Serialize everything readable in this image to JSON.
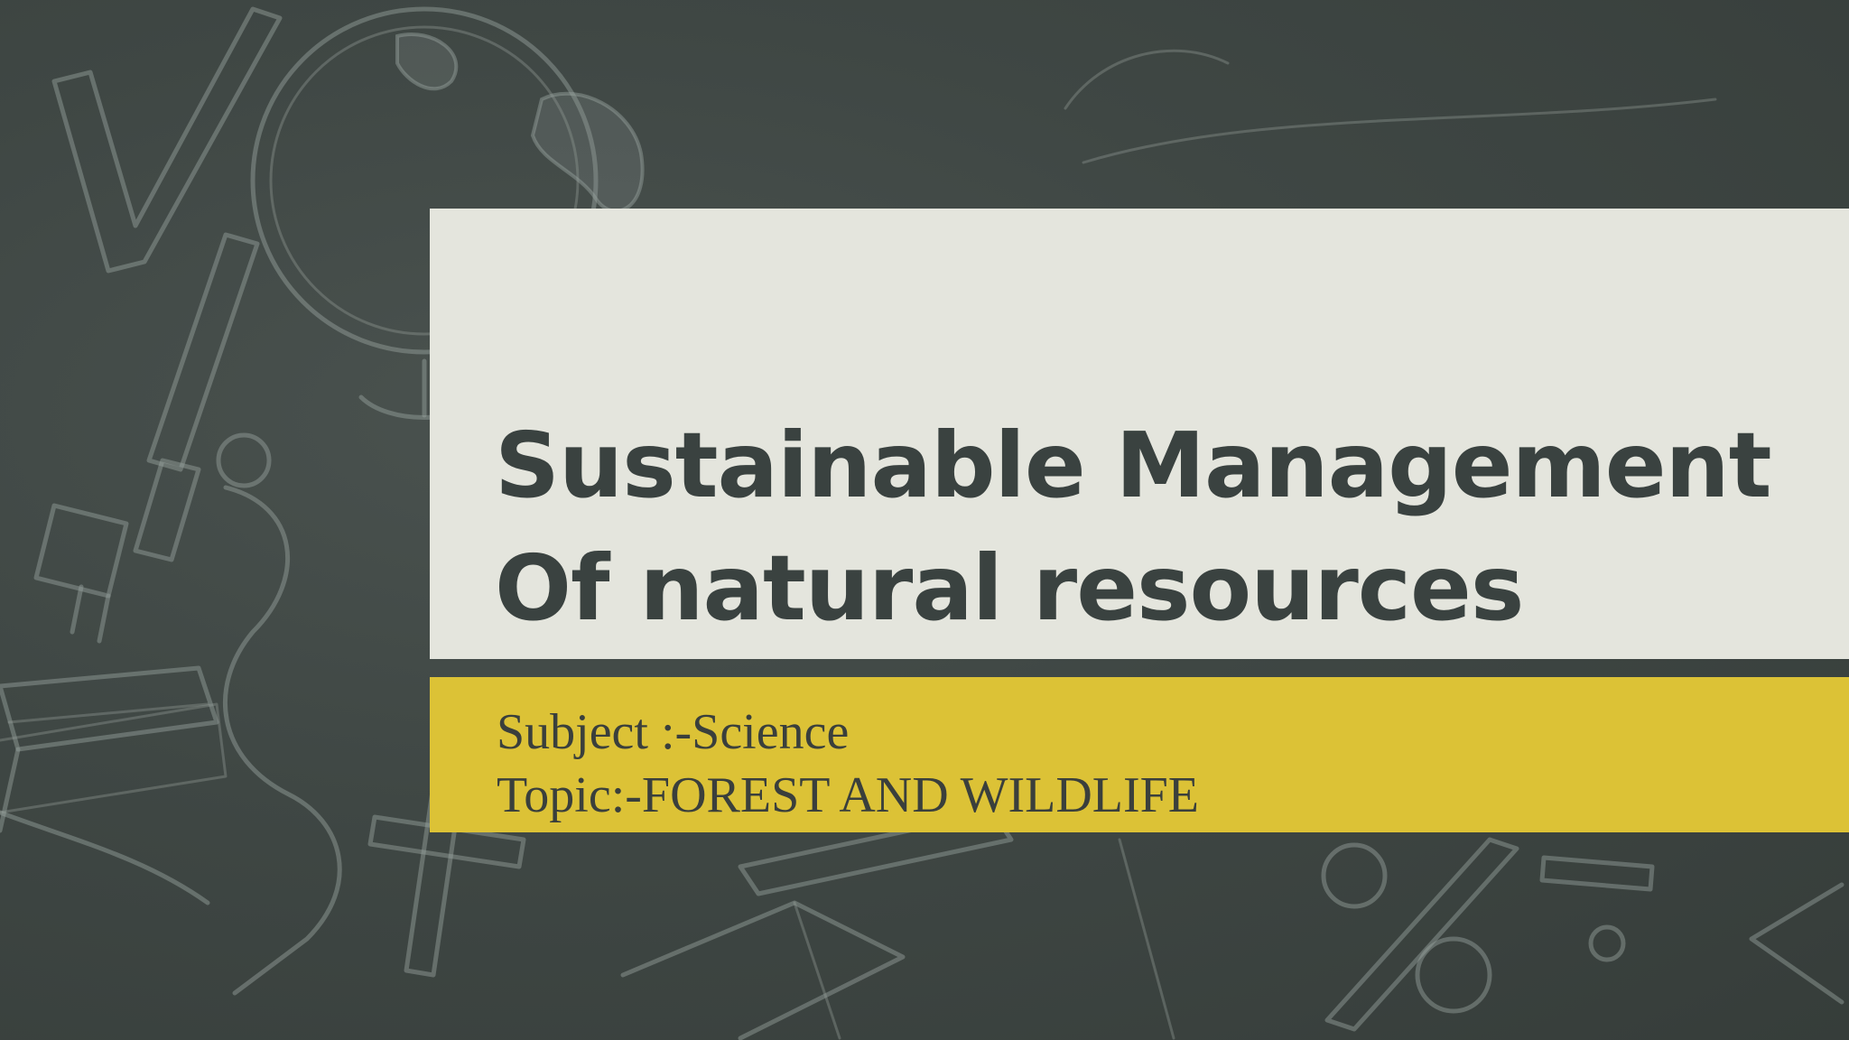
{
  "slide": {
    "title_line1": "Sustainable Management",
    "title_line2": "Of natural resources",
    "subject_line": "Subject :-Science",
    "topic_line": "Topic:-FOREST AND WILDLIFE"
  },
  "background": {
    "theme": "chalkboard",
    "doodles": [
      "checkmark-icon",
      "globe-icon",
      "microscope-icon",
      "books-icon",
      "plus-icon",
      "percent-icon",
      "minus-icon",
      "open-book-icon",
      "less-than-icon"
    ]
  },
  "colors": {
    "chalkboard": "#3d4542",
    "title_panel": "#e4e5dd",
    "subtitle_band": "#dcc236",
    "title_text": "#3a4240"
  }
}
